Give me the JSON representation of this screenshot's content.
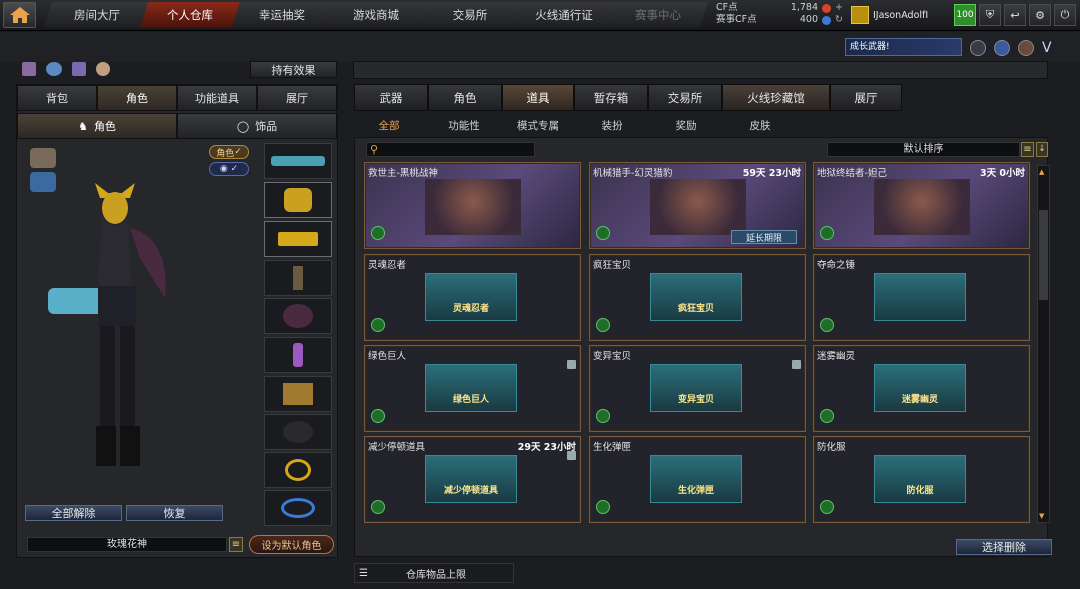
{
  "nav": {
    "tabs": [
      {
        "label": "房间大厅"
      },
      {
        "label": "个人仓库"
      },
      {
        "label": "幸运抽奖"
      },
      {
        "label": "游戏商城"
      },
      {
        "label": "交易所"
      },
      {
        "label": "火线通行证"
      },
      {
        "label": "赛事中心"
      }
    ],
    "cf_label": "CF点",
    "cf_value": "1,784",
    "match_label": "赛事CF点",
    "match_value": "400",
    "username": "IJasonAdolfI",
    "level": "100"
  },
  "banner": {
    "text": "成长武器!"
  },
  "left": {
    "effects_button": "持有效果",
    "tabs": [
      {
        "label": "背包"
      },
      {
        "label": "角色"
      },
      {
        "label": "功能道具"
      },
      {
        "label": "展厅"
      }
    ],
    "subtabs": [
      {
        "label": "角色"
      },
      {
        "label": "饰品"
      }
    ],
    "badge_role": "角色",
    "release_all": "全部解除",
    "restore": "恢复",
    "char_name": "玫瑰花神",
    "set_default": "设为默认角色"
  },
  "right": {
    "tabs": [
      {
        "label": "武器"
      },
      {
        "label": "角色"
      },
      {
        "label": "道具"
      },
      {
        "label": "暂存箱"
      },
      {
        "label": "交易所"
      },
      {
        "label": "火线珍藏馆"
      },
      {
        "label": "展厅"
      }
    ],
    "subtabs": [
      {
        "label": "全部"
      },
      {
        "label": "功能性"
      },
      {
        "label": "模式专属"
      },
      {
        "label": "装扮"
      },
      {
        "label": "奖励"
      },
      {
        "label": "皮肤"
      }
    ],
    "sort_label": "默认排序",
    "items": [
      {
        "name": "救世主-黑桃战神",
        "time": "",
        "img_label": ""
      },
      {
        "name": "机械猎手-幻灵猎豹",
        "time": "59天 23小时",
        "img_label": "",
        "button": "延长期限"
      },
      {
        "name": "地狱终结者-妲己",
        "time": "3天 0小时",
        "img_label": ""
      },
      {
        "name": "灵魂忍者",
        "time": "",
        "img_label": "灵魂忍者"
      },
      {
        "name": "疯狂宝贝",
        "time": "",
        "img_label": "疯狂宝贝"
      },
      {
        "name": "夺命之锤",
        "time": "",
        "img_label": ""
      },
      {
        "name": "绿色巨人",
        "time": "",
        "img_label": "绿色巨人"
      },
      {
        "name": "变异宝贝",
        "time": "",
        "img_label": "变异宝贝"
      },
      {
        "name": "迷雾幽灵",
        "time": "",
        "img_label": "迷雾幽灵"
      },
      {
        "name": "减少停顿道具",
        "time": "29天 23小时",
        "img_label": "减少停顿道具"
      },
      {
        "name": "生化弹匣",
        "time": "",
        "img_label": "生化弹匣"
      },
      {
        "name": "防化服",
        "time": "",
        "img_label": "防化服"
      }
    ],
    "select_delete": "选择删除",
    "capacity": "仓库物品上限"
  }
}
